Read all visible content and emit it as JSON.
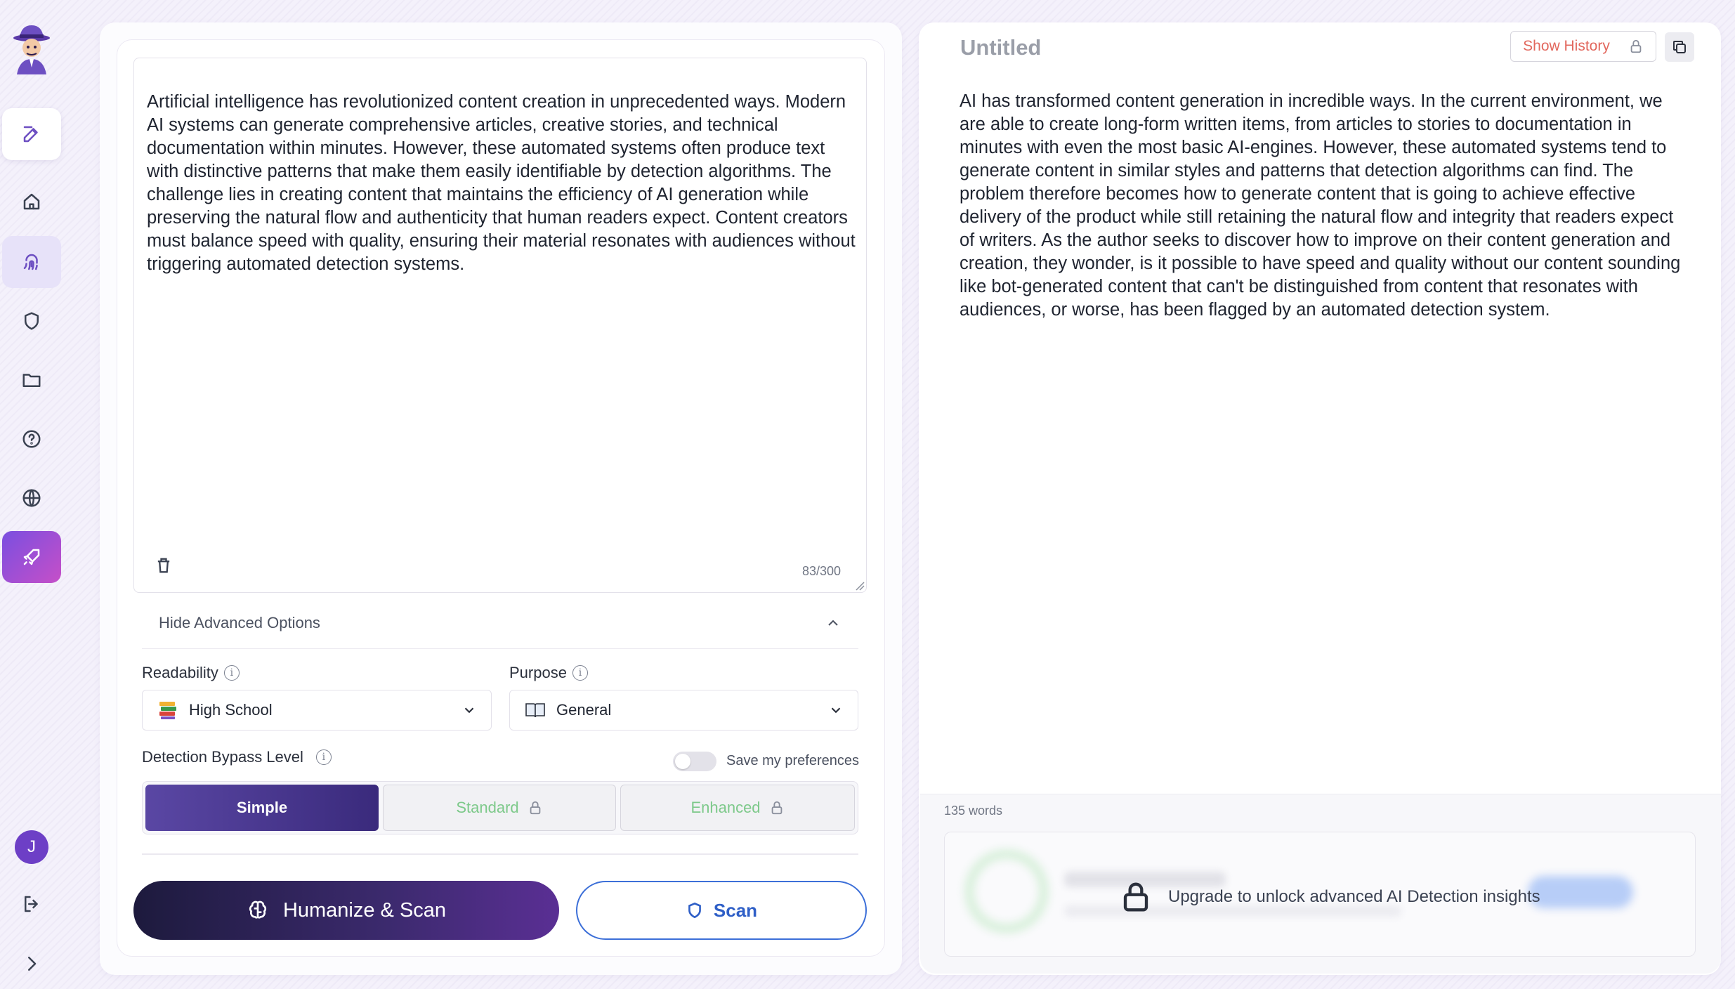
{
  "sidebar": {
    "items": [
      "edit",
      "home",
      "fingerprint",
      "shield",
      "folder",
      "help",
      "globe",
      "rocket"
    ],
    "avatar_initial": "J"
  },
  "editor": {
    "input_text": "Artificial intelligence has revolutionized content creation in unprecedented ways. Modern AI systems can generate comprehensive articles, creative stories, and technical documentation within minutes. However, these automated systems often produce text with distinctive patterns that make them easily identifiable by detection algorithms. The challenge lies in creating content that maintains the efficiency of AI generation while preserving the natural flow and authenticity that human readers expect. Content creators must balance speed with quality, ensuring their material resonates with audiences without triggering automated detection systems.",
    "char_counter": "83/300"
  },
  "advanced": {
    "toggle_label": "Hide Advanced Options",
    "readability_label": "Readability",
    "readability_value": "High School",
    "purpose_label": "Purpose",
    "purpose_value": "General",
    "bypass_label": "Detection Bypass Level",
    "save_pref_label": "Save my preferences",
    "save_pref_on": false,
    "levels": [
      "Simple",
      "Standard",
      "Enhanced"
    ],
    "selected_level": "Simple"
  },
  "actions": {
    "humanize_label": "Humanize & Scan",
    "scan_label": "Scan"
  },
  "output": {
    "title": "Untitled",
    "show_history_label": "Show History",
    "text": "AI has transformed content generation in incredible ways. In the current environment, we are able to create long-form written items, from articles to stories to documentation in minutes with even the most basic AI-engines. However, these automated systems tend to generate content in similar styles and patterns that detection algorithms can find. The problem therefore becomes how to generate content that is going to achieve effective delivery of the product while still retaining the natural flow and integrity that readers expect of writers. As the author seeks to discover how to improve on their content generation and creation, they wonder, is it possible to have speed and quality without our content sounding like bot-generated content that can't be distinguished from content that resonates with audiences, or worse, has been flagged by an automated detection system.",
    "word_count": "135 words",
    "upgrade_message": "Upgrade to unlock advanced AI Detection insights"
  },
  "colors": {
    "accent": "#6d4fc2",
    "scan_blue": "#2f5fc7",
    "history_red": "#e2685e",
    "locked_green": "#7dc98a"
  }
}
